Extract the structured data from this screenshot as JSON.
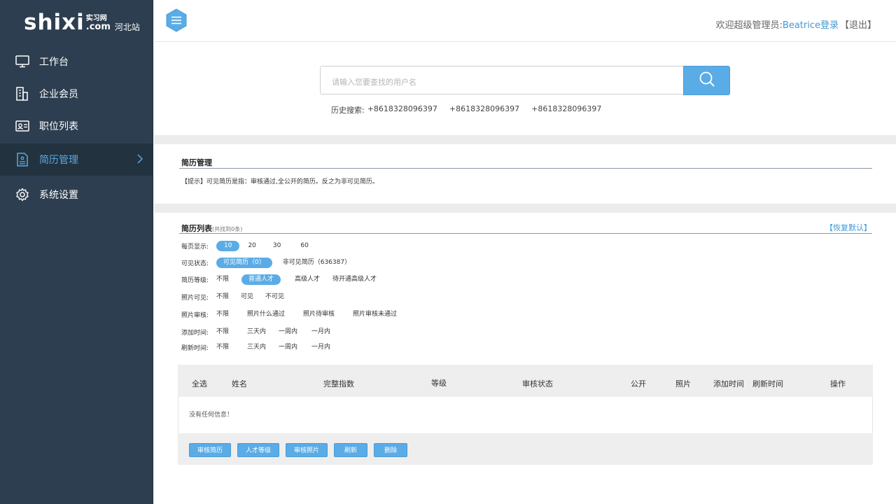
{
  "logo": {
    "brand": "shixi",
    "cn": "实习网",
    "com": ".com",
    "site": "河北站"
  },
  "sidebar": {
    "items": [
      {
        "label": "工作台",
        "icon": "monitor-icon"
      },
      {
        "label": "企业会员",
        "icon": "building-icon"
      },
      {
        "label": "职位列表",
        "icon": "id-card-icon"
      },
      {
        "label": "简历管理",
        "icon": "resume-icon",
        "active": true
      },
      {
        "label": "系统设置",
        "icon": "gear-icon"
      }
    ]
  },
  "header": {
    "welcome_prefix": "欢迎超级管理员:",
    "user": "Beatrice登录",
    "logout": "【退出】"
  },
  "search": {
    "placeholder": "请输入您要查找的用户名",
    "history_label": "历史搜索:",
    "history": [
      "+8618328096397",
      "+8618328096397",
      "+8618328096397"
    ]
  },
  "resume_panel": {
    "title": "简历管理",
    "tip": "【提示】可见简历是指：审核通过,全公开的简历。反之为非可见简历。"
  },
  "list_panel": {
    "title": "简历列表",
    "count": "(共找到0条)",
    "restore": "【恢复默认】",
    "filters": [
      {
        "label": "每页显示:",
        "options": [
          "10",
          "20",
          "30",
          "60"
        ],
        "selected": 0
      },
      {
        "label": "可见状态:",
        "options": [
          "可见简历（0）",
          "非可见简历（636387）"
        ],
        "selected": 0
      },
      {
        "label": "简历等级:",
        "options": [
          "不限",
          "普通人才",
          "高级人才",
          "待开通高级人才"
        ],
        "selected": 1
      },
      {
        "label": "照片可见:",
        "options": [
          "不限",
          "可见",
          "不可见"
        ],
        "selected": -1
      },
      {
        "label": "照片审核:",
        "options": [
          "不限",
          "照片什么通过",
          "照片待审核",
          "照片审核未通过"
        ],
        "selected": -1
      },
      {
        "label": "添加时间:",
        "options": [
          "不限",
          "三天内",
          "一周内",
          "一月内"
        ],
        "selected": -1
      },
      {
        "label": "刷新时间:",
        "options": [
          "不限",
          "三天内",
          "一周内",
          "一月内"
        ],
        "selected": -1
      }
    ]
  },
  "table": {
    "columns": [
      "全选",
      "姓名",
      "完整指数",
      "等级",
      "审核状态",
      "公开",
      "照片",
      "添加时间",
      "刷新时间",
      "操作"
    ],
    "empty": "没有任何信息！",
    "actions": [
      "审核简历",
      "人才等级",
      "审核照片",
      "刷新",
      "删除"
    ]
  },
  "colors": {
    "sidebar": "#2d3e50",
    "accent": "#5aace6",
    "link": "#3d98d6"
  }
}
